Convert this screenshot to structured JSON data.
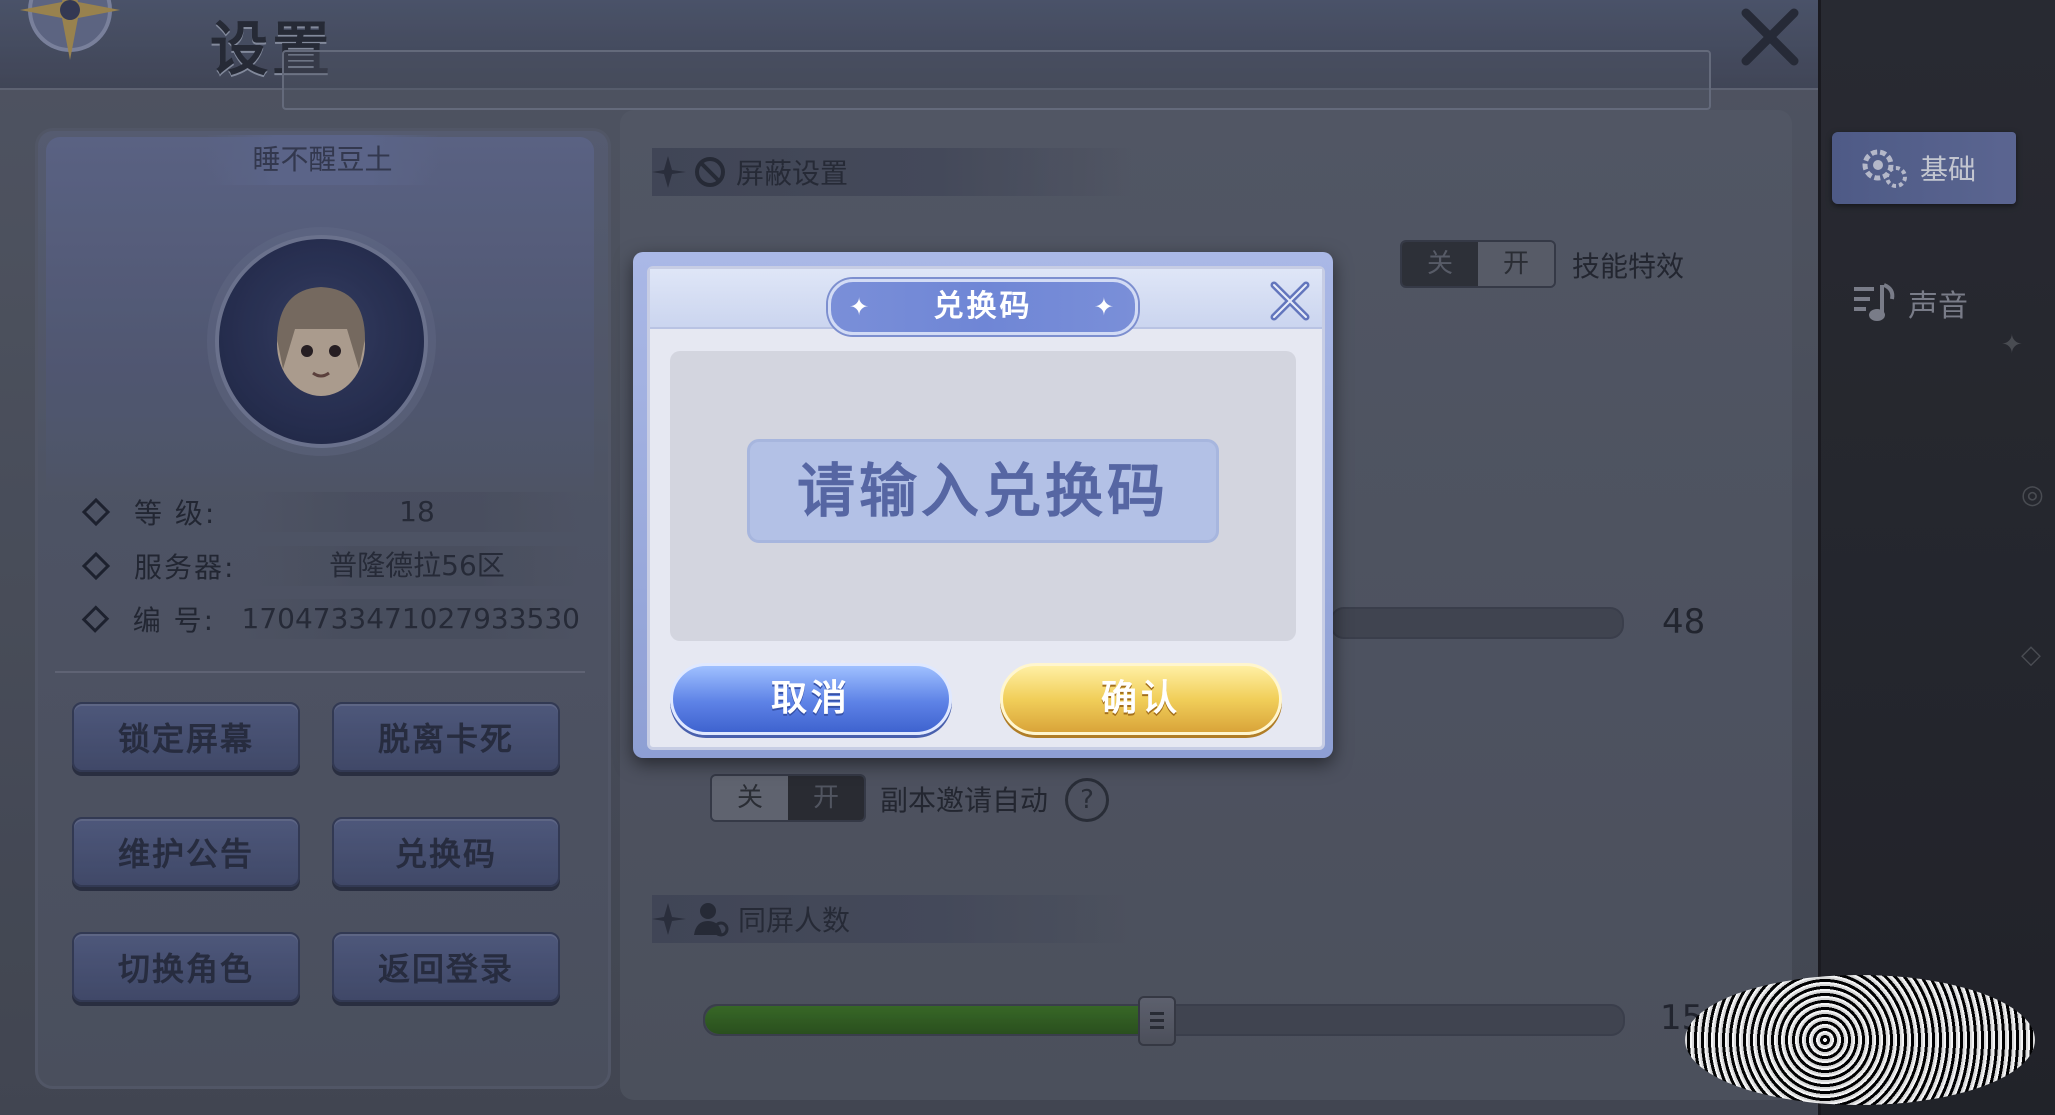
{
  "window": {
    "title": "设置"
  },
  "sidebar": {
    "tabs": [
      {
        "label": "基础",
        "icon": "gear-icon",
        "active": true
      },
      {
        "label": "声音",
        "icon": "music-note-icon",
        "active": false
      }
    ]
  },
  "profile": {
    "player_name": "睡不醒豆土",
    "rows": [
      {
        "label": "等 级:",
        "value": "18"
      },
      {
        "label": "服务器:",
        "value": "普隆德拉56区"
      },
      {
        "label": "编 号:",
        "value": "1704733471027933530"
      }
    ],
    "buttons": [
      {
        "label": "锁定屏幕"
      },
      {
        "label": "脱离卡死"
      },
      {
        "label": "维护公告"
      },
      {
        "label": "兑换码"
      },
      {
        "label": "切换角色"
      },
      {
        "label": "返回登录"
      }
    ]
  },
  "settings": {
    "shield_section": {
      "title": "屏蔽设置"
    },
    "skill_effect": {
      "off_label": "关",
      "on_label": "开",
      "label": "技能特效"
    },
    "slider_top": {
      "value": "48"
    },
    "dungeon_invite": {
      "off_label": "关",
      "on_label": "开",
      "label": "副本邀请自动",
      "help": "?"
    },
    "screen_players": {
      "title": "同屏人数",
      "value": "15",
      "fill_fraction": 0.49
    }
  },
  "dialog": {
    "title": "兑换码",
    "input_placeholder": "请输入兑换码",
    "cancel_label": "取消",
    "confirm_label": "确认"
  },
  "colors": {
    "dialog_accent": "#6f86d6",
    "confirm_gold": "#f1cf5a",
    "cancel_blue": "#5d82e6",
    "slider_green": "#3f7a2a"
  }
}
